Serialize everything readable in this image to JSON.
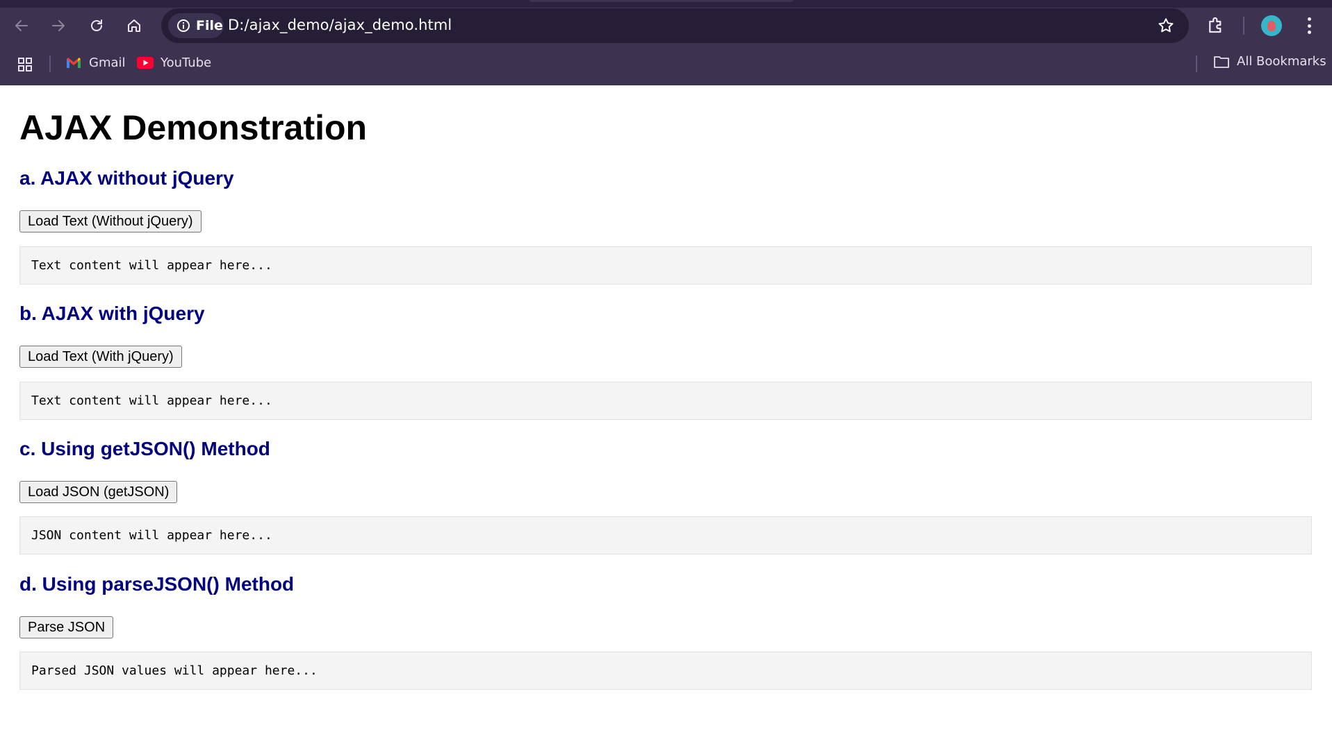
{
  "browser": {
    "site_chip_label": "File",
    "url": "D:/ajax_demo/ajax_demo.html",
    "bookmarks": [
      {
        "label": "Gmail",
        "icon": "gmail-icon"
      },
      {
        "label": "YouTube",
        "icon": "youtube-icon"
      }
    ],
    "all_bookmarks_label": "All Bookmarks",
    "colors": {
      "chrome": "#3d3351",
      "omnibox": "#261e37"
    }
  },
  "page": {
    "title": "AJAX Demonstration",
    "heading_color": "#000080",
    "sections": [
      {
        "title": "a. AJAX without jQuery",
        "button": "Load Text (Without jQuery)",
        "output": "Text content will appear here..."
      },
      {
        "title": "b. AJAX with jQuery",
        "button": "Load Text (With jQuery)",
        "output": "Text content will appear here..."
      },
      {
        "title": "c. Using getJSON() Method",
        "button": "Load JSON (getJSON)",
        "output": "JSON content will appear here..."
      },
      {
        "title": "d. Using parseJSON() Method",
        "button": "Parse JSON",
        "output": "Parsed JSON values will appear here..."
      }
    ]
  }
}
